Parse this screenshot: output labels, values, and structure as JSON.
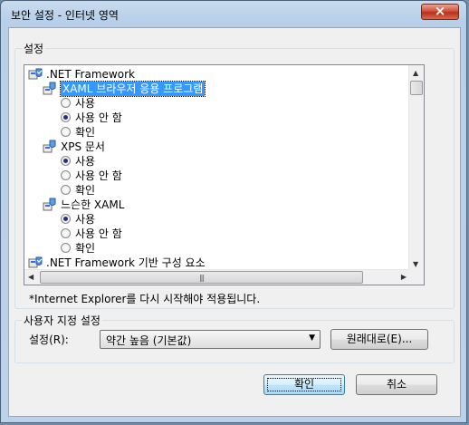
{
  "window": {
    "title": "보안 설정 - 인터넷 영역",
    "close_glyph": "×"
  },
  "settings_group": {
    "label": "설정"
  },
  "tree": [
    {
      "type": "category",
      "label": ".NET Framework",
      "icon": "shield-settings-icon"
    },
    {
      "type": "setting",
      "label": "XAML 브라우저 응용 프로그램",
      "icon": "setting-node-icon",
      "selected": true
    },
    {
      "type": "radio",
      "label": "사용",
      "checked": false
    },
    {
      "type": "radio",
      "label": "사용 안 함",
      "checked": true
    },
    {
      "type": "radio",
      "label": "확인",
      "checked": false
    },
    {
      "type": "setting",
      "label": "XPS 문서",
      "icon": "setting-node-icon",
      "selected": false
    },
    {
      "type": "radio",
      "label": "사용",
      "checked": true
    },
    {
      "type": "radio",
      "label": "사용 안 함",
      "checked": false
    },
    {
      "type": "radio",
      "label": "확인",
      "checked": false
    },
    {
      "type": "setting",
      "label": "느슨한 XAML",
      "icon": "setting-node-icon",
      "selected": false
    },
    {
      "type": "radio",
      "label": "사용",
      "checked": true
    },
    {
      "type": "radio",
      "label": "사용 안 함",
      "checked": false
    },
    {
      "type": "radio",
      "label": "확인",
      "checked": false
    },
    {
      "type": "category",
      "label": ".NET Framework 기반 구성 요소",
      "icon": "component-settings-icon"
    }
  ],
  "restart_note": "*Internet Explorer를 다시 시작해야 적용됩니다.",
  "custom_group": {
    "label": "사용자 지정 설정",
    "combo_label": "설정(R):",
    "combo_value": "약간 높음 (기본값)",
    "reset_button": "원래대로(E)..."
  },
  "buttons": {
    "ok": "확인",
    "cancel": "취소"
  },
  "colors": {
    "selection": "#3399ff",
    "close": "#c7422e"
  }
}
